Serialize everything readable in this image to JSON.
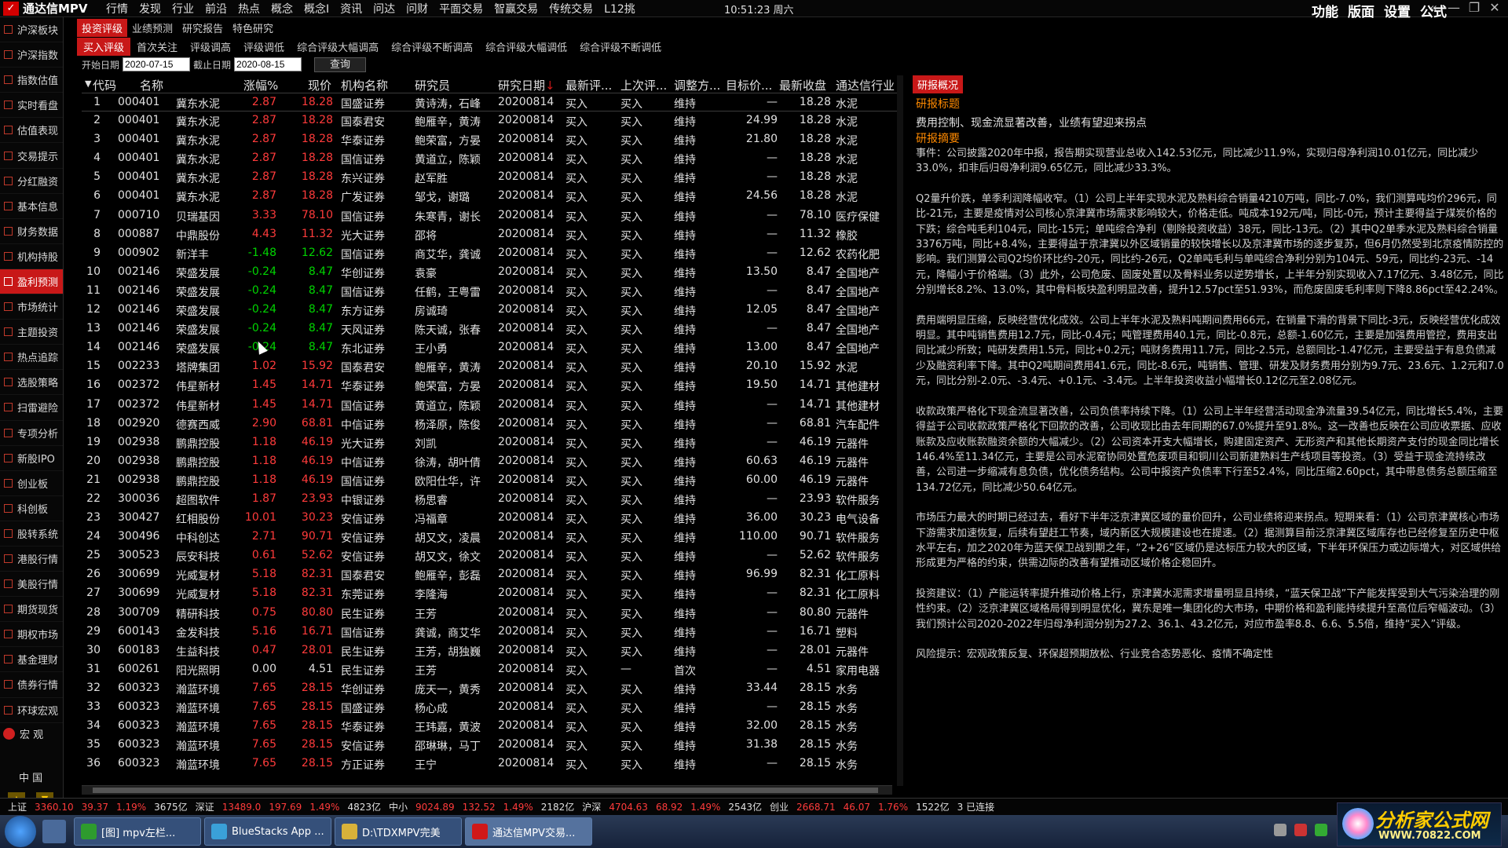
{
  "app": {
    "title": "通达信MPV",
    "clock": "10:51:23 周六"
  },
  "menu": [
    "行情",
    "发现",
    "行业",
    "前沿",
    "热点",
    "概念",
    "概念I",
    "资讯",
    "问达",
    "问财",
    "平面交易",
    "智赢交易",
    "传统交易",
    "L12挑"
  ],
  "right_menu": [
    "功能",
    "版面",
    "设置",
    "公式"
  ],
  "window_controls": {
    "collapse": "«",
    "minimize": "—",
    "restore": "❐",
    "close": "✕"
  },
  "sidebar": {
    "items": [
      "沪深板块",
      "沪深指数",
      "指数估值",
      "实时看盘",
      "估值表现",
      "交易提示",
      "分红融资",
      "基本信息",
      "财务数据",
      "机构持股",
      "盈利预测",
      "市场统计",
      "主题投资",
      "热点追踪",
      "选股策略",
      "扫雷避险",
      "专项分析",
      "新股IPO",
      "创业板",
      "科创板",
      "股转系统",
      "港股行情",
      "美股行情",
      "期货现货",
      "期权市场",
      "基金理财",
      "债券行情",
      "环球宏观"
    ],
    "active_index": 10,
    "macro": "宏  观",
    "china": "中  国",
    "up": "▲",
    "down": "▼"
  },
  "tabs1": [
    "投资评级",
    "业绩预测",
    "研究报告",
    "特色研究"
  ],
  "tabs2": [
    "买入评级",
    "首次关注",
    "评级调高",
    "评级调低",
    "综合评级大幅调高",
    "综合评级不断调高",
    "综合评级大幅调低",
    "综合评级不断调低"
  ],
  "filter": {
    "start_label": "开始日期",
    "start_value": "2020-07-15",
    "end_label": "截止日期",
    "end_value": "2020-08-15",
    "query": "查询"
  },
  "columns": {
    "code": "代码",
    "name": "名称",
    "chg": "涨幅%",
    "price": "现价",
    "org": "机构名称",
    "res": "研究员",
    "date": "研究日期",
    "latest": "最新评...",
    "prev": "上次评...",
    "adj": "调整方...",
    "target": "目标价...",
    "close": "最新收盘",
    "ind": "通达信行业",
    "sort_arrow": "↓"
  },
  "rows": [
    [
      "1",
      "000401",
      "冀东水泥",
      "2.87",
      "18.28",
      "国盛证券",
      "黄诗涛，石峰",
      "20200814",
      "买入",
      "买入",
      "维持",
      "—",
      "18.28",
      "水泥"
    ],
    [
      "2",
      "000401",
      "冀东水泥",
      "2.87",
      "18.28",
      "国泰君安",
      "鲍雁辛，黄涛",
      "20200814",
      "买入",
      "买入",
      "维持",
      "24.99",
      "18.28",
      "水泥"
    ],
    [
      "3",
      "000401",
      "冀东水泥",
      "2.87",
      "18.28",
      "华泰证券",
      "鲍荣富，方晏",
      "20200814",
      "买入",
      "买入",
      "维持",
      "21.80",
      "18.28",
      "水泥"
    ],
    [
      "4",
      "000401",
      "冀东水泥",
      "2.87",
      "18.28",
      "国信证券",
      "黄道立，陈颖",
      "20200814",
      "买入",
      "买入",
      "维持",
      "—",
      "18.28",
      "水泥"
    ],
    [
      "5",
      "000401",
      "冀东水泥",
      "2.87",
      "18.28",
      "东兴证券",
      "赵军胜",
      "20200814",
      "买入",
      "买入",
      "维持",
      "—",
      "18.28",
      "水泥"
    ],
    [
      "6",
      "000401",
      "冀东水泥",
      "2.87",
      "18.28",
      "广发证券",
      "邹戈，谢璐",
      "20200814",
      "买入",
      "买入",
      "维持",
      "24.56",
      "18.28",
      "水泥"
    ],
    [
      "7",
      "000710",
      "贝瑞基因",
      "3.33",
      "78.10",
      "国信证券",
      "朱寒青，谢长",
      "20200814",
      "买入",
      "买入",
      "维持",
      "—",
      "78.10",
      "医疗保健"
    ],
    [
      "8",
      "000887",
      "中鼎股份",
      "4.43",
      "11.32",
      "光大证券",
      "邵将",
      "20200814",
      "买入",
      "买入",
      "维持",
      "—",
      "11.32",
      "橡胶"
    ],
    [
      "9",
      "000902",
      "新洋丰",
      "-1.48",
      "12.62",
      "国信证券",
      "商艾华，龚诚",
      "20200814",
      "买入",
      "买入",
      "维持",
      "—",
      "12.62",
      "农药化肥"
    ],
    [
      "10",
      "002146",
      "荣盛发展",
      "-0.24",
      "8.47",
      "华创证券",
      "袁豪",
      "20200814",
      "买入",
      "买入",
      "维持",
      "13.50",
      "8.47",
      "全国地产"
    ],
    [
      "11",
      "002146",
      "荣盛发展",
      "-0.24",
      "8.47",
      "国信证券",
      "任鹤，王粤雷",
      "20200814",
      "买入",
      "买入",
      "维持",
      "—",
      "8.47",
      "全国地产"
    ],
    [
      "12",
      "002146",
      "荣盛发展",
      "-0.24",
      "8.47",
      "东方证券",
      "房诚琦",
      "20200814",
      "买入",
      "买入",
      "维持",
      "12.05",
      "8.47",
      "全国地产"
    ],
    [
      "13",
      "002146",
      "荣盛发展",
      "-0.24",
      "8.47",
      "天风证券",
      "陈天诚，张春",
      "20200814",
      "买入",
      "买入",
      "维持",
      "—",
      "8.47",
      "全国地产"
    ],
    [
      "14",
      "002146",
      "荣盛发展",
      "-0.24",
      "8.47",
      "东北证券",
      "王小勇",
      "20200814",
      "买入",
      "买入",
      "维持",
      "13.00",
      "8.47",
      "全国地产"
    ],
    [
      "15",
      "002233",
      "塔牌集团",
      "1.02",
      "15.92",
      "国泰君安",
      "鲍雁辛，黄涛",
      "20200814",
      "买入",
      "买入",
      "维持",
      "20.10",
      "15.92",
      "水泥"
    ],
    [
      "16",
      "002372",
      "伟星新材",
      "1.45",
      "14.71",
      "华泰证券",
      "鲍荣富，方晏",
      "20200814",
      "买入",
      "买入",
      "维持",
      "19.50",
      "14.71",
      "其他建材"
    ],
    [
      "17",
      "002372",
      "伟星新材",
      "1.45",
      "14.71",
      "国信证券",
      "黄道立，陈颖",
      "20200814",
      "买入",
      "买入",
      "维持",
      "—",
      "14.71",
      "其他建材"
    ],
    [
      "18",
      "002920",
      "德赛西威",
      "2.90",
      "68.81",
      "中信证券",
      "杨泽原，陈俊",
      "20200814",
      "买入",
      "买入",
      "维持",
      "—",
      "68.81",
      "汽车配件"
    ],
    [
      "19",
      "002938",
      "鹏鼎控股",
      "1.18",
      "46.19",
      "光大证券",
      "刘凯",
      "20200814",
      "买入",
      "买入",
      "维持",
      "—",
      "46.19",
      "元器件"
    ],
    [
      "20",
      "002938",
      "鹏鼎控股",
      "1.18",
      "46.19",
      "中信证券",
      "徐涛，胡叶倩",
      "20200814",
      "买入",
      "买入",
      "维持",
      "60.63",
      "46.19",
      "元器件"
    ],
    [
      "21",
      "002938",
      "鹏鼎控股",
      "1.18",
      "46.19",
      "国信证券",
      "欧阳仕华，许",
      "20200814",
      "买入",
      "买入",
      "维持",
      "60.00",
      "46.19",
      "元器件"
    ],
    [
      "22",
      "300036",
      "超图软件",
      "1.87",
      "23.93",
      "中银证券",
      "杨思睿",
      "20200814",
      "买入",
      "买入",
      "维持",
      "—",
      "23.93",
      "软件服务"
    ],
    [
      "23",
      "300427",
      "红相股份",
      "10.01",
      "30.23",
      "安信证券",
      "冯福章",
      "20200814",
      "买入",
      "买入",
      "维持",
      "36.00",
      "30.23",
      "电气设备"
    ],
    [
      "24",
      "300496",
      "中科创达",
      "2.71",
      "90.71",
      "安信证券",
      "胡又文，凌晨",
      "20200814",
      "买入",
      "买入",
      "维持",
      "110.00",
      "90.71",
      "软件服务"
    ],
    [
      "25",
      "300523",
      "辰安科技",
      "0.61",
      "52.62",
      "安信证券",
      "胡又文，徐文",
      "20200814",
      "买入",
      "买入",
      "维持",
      "—",
      "52.62",
      "软件服务"
    ],
    [
      "26",
      "300699",
      "光威复材",
      "5.18",
      "82.31",
      "国泰君安",
      "鲍雁辛，彭磊",
      "20200814",
      "买入",
      "买入",
      "维持",
      "96.99",
      "82.31",
      "化工原料"
    ],
    [
      "27",
      "300699",
      "光威复材",
      "5.18",
      "82.31",
      "东莞证券",
      "李隆海",
      "20200814",
      "买入",
      "买入",
      "维持",
      "—",
      "82.31",
      "化工原料"
    ],
    [
      "28",
      "300709",
      "精研科技",
      "0.75",
      "80.80",
      "民生证券",
      "王芳",
      "20200814",
      "买入",
      "买入",
      "维持",
      "—",
      "80.80",
      "元器件"
    ],
    [
      "29",
      "600143",
      "金发科技",
      "5.16",
      "16.71",
      "国信证券",
      "龚诚，商艾华",
      "20200814",
      "买入",
      "买入",
      "维持",
      "—",
      "16.71",
      "塑料"
    ],
    [
      "30",
      "600183",
      "生益科技",
      "0.47",
      "28.01",
      "民生证券",
      "王芳，胡独巍",
      "20200814",
      "买入",
      "买入",
      "维持",
      "—",
      "28.01",
      "元器件"
    ],
    [
      "31",
      "600261",
      "阳光照明",
      "0.00",
      "4.51",
      "民生证券",
      "王芳",
      "20200814",
      "买入",
      "—",
      "首次",
      "—",
      "4.51",
      "家用电器"
    ],
    [
      "32",
      "600323",
      "瀚蓝环境",
      "7.65",
      "28.15",
      "华创证券",
      "庞天一，黄秀",
      "20200814",
      "买入",
      "买入",
      "维持",
      "33.44",
      "28.15",
      "水务"
    ],
    [
      "33",
      "600323",
      "瀚蓝环境",
      "7.65",
      "28.15",
      "国盛证券",
      "杨心成",
      "20200814",
      "买入",
      "买入",
      "维持",
      "—",
      "28.15",
      "水务"
    ],
    [
      "34",
      "600323",
      "瀚蓝环境",
      "7.65",
      "28.15",
      "华泰证券",
      "王玮嘉，黄波",
      "20200814",
      "买入",
      "买入",
      "维持",
      "32.00",
      "28.15",
      "水务"
    ],
    [
      "35",
      "600323",
      "瀚蓝环境",
      "7.65",
      "28.15",
      "安信证券",
      "邵琳琳，马丁",
      "20200814",
      "买入",
      "买入",
      "维持",
      "31.38",
      "28.15",
      "水务"
    ],
    [
      "36",
      "600323",
      "瀚蓝环境",
      "7.65",
      "28.15",
      "方正证券",
      "王宁",
      "20200814",
      "买入",
      "买入",
      "维持",
      "—",
      "28.15",
      "水务"
    ]
  ],
  "detail": {
    "title": "研报概况",
    "heading_label": "研报标题",
    "heading": "费用控制、现金流显著改善，业绩有望迎来拐点",
    "summary_label": "研报摘要",
    "paragraphs": [
      "事件：公司披露2020年中报，报告期实现营业总收入142.53亿元，同比减少11.9%，实现归母净利润10.01亿元，同比减少33.0%，扣非后归母净利润9.65亿元，同比减少33.3%。",
      "Q2量升价跌，单季利润降幅收窄。（1）公司上半年实现水泥及熟料综合销量4210万吨，同比-7.0%，我们测算吨均价296元，同比-21元，主要是疫情对公司核心京津冀市场需求影响较大，价格走低。吨成本192元/吨，同比-0元，预计主要得益于煤炭价格的下跌；综合吨毛利104元，同比-15元；单吨综合净利（剔除投资收益）38元，同比-13元。（2）其中Q2单季水泥及熟料综合销量3376万吨，同比+8.4%，主要得益于京津冀以外区域销量的较快增长以及京津冀市场的逐步复苏，但6月仍然受到北京疫情防控的影响。我们测算公司Q2均价环比约-20元，同比约-26元，Q2单吨毛利与单吨综合净利分别为104元、59元，同比约-23元、-14元，降幅小于价格端。（3）此外，公司危废、固废处置以及骨料业务以逆势增长，上半年分别实现收入7.17亿元、3.48亿元，同比分别增长8.2%、13.0%，其中骨料板块盈利明显改善，提升12.57pct至51.93%，而危废固废毛利率则下降8.86pct至42.24%。",
      "费用端明显压缩，反映经营优化成效。公司上半年水泥及熟料吨期间费用66元，在销量下滑的背景下同比-3元，反映经营优化成效明显。其中吨销售费用12.7元，同比-0.4元；吨管理费用40.1元，同比-0.8元，总额-1.60亿元，主要是加强费用管控，费用支出同比减少所致；吨研发费用1.5元，同比+0.2元；吨财务费用11.7元，同比-2.5元，总额同比-1.47亿元，主要受益于有息负债减少及融资利率下降。其中Q2吨期间费用41.6元，同比-8.6元，吨销售、管理、研发及财务费用分别为9.7元、23.6元、1.2元和7.0元，同比分别-2.0元、-3.4元、+0.1元、-3.4元。上半年投资收益小幅增长0.12亿元至2.08亿元。",
      "收款政策严格化下现金流显著改善，公司负债率持续下降。（1）公司上半年经营活动现金净流量39.54亿元，同比增长5.4%，主要得益于公司收款政策严格化下回款的改善，公司收现比由去年同期的67.0%提升至91.8%。这一改善也反映在公司应收票据、应收账款及应收账款融资余额的大幅减少。（2）公司资本开支大幅增长，购建固定资产、无形资产和其他长期资产支付的现金同比增长146.4%至11.34亿元，主要是公司水泥窑协同处置危废项目和铜川公司新建熟料生产线项目等投资。（3）受益于现金流持续改善，公司进一步缩减有息负债，优化债务结构。公司中报资产负债率下行至52.4%，同比压缩2.60pct，其中带息债务总额压缩至134.72亿元，同比减少50.64亿元。",
      "市场压力最大的时期已经过去，看好下半年泛京津冀区域的量价回升，公司业绩将迎来拐点。短期来看：（1）公司京津冀核心市场下游需求加速恢复，后续有望赶工节奏，域内新区大规模建设也在提速。（2）据测算目前泛京津冀区域库存也已经修复至历史中枢水平左右，加之2020年为蓝天保卫战到期之年，“2+26”区域仍是达标压力较大的区域，下半年环保压力或边际增大，对区域供给形成更为严格的约束，供需边际的改善有望推动区域价格企稳回升。",
      "投资建议：（1）产能运转率提升推动价格上行，京津冀水泥需求增量明显且持续，“蓝天保卫战”下产能发挥受到大气污染治理的刚性约束。（2）泛京津冀区域格局得到明显优化，冀东是唯一集团化的大市场，中期价格和盈利能持续提升至高位后窄幅波动。（3）我们预计公司2020-2022年归母净利润分别为27.2、36.1、43.2亿元，对应市盈率8.8、6.6、5.5倍，维持“买入”评级。",
      "风险提示：宏观政策反复、环保超预期放松、行业竞合态势恶化、疫情不确定性"
    ]
  },
  "statusbar": [
    {
      "t": "上证",
      "c": "wht"
    },
    {
      "t": "3360.10",
      "c": "red"
    },
    {
      "t": "39.37",
      "c": "red"
    },
    {
      "t": "1.19%",
      "c": "red"
    },
    {
      "t": "3675亿",
      "c": "wht"
    },
    {
      "t": "深证",
      "c": "wht"
    },
    {
      "t": "13489.0",
      "c": "red"
    },
    {
      "t": "197.69",
      "c": "red"
    },
    {
      "t": "1.49%",
      "c": "red"
    },
    {
      "t": "4823亿",
      "c": "wht"
    },
    {
      "t": "中小",
      "c": "wht"
    },
    {
      "t": "9024.89",
      "c": "red"
    },
    {
      "t": "132.52",
      "c": "red"
    },
    {
      "t": "1.49%",
      "c": "red"
    },
    {
      "t": "2182亿",
      "c": "wht"
    },
    {
      "t": "沪深",
      "c": "wht"
    },
    {
      "t": "4704.63",
      "c": "red"
    },
    {
      "t": "68.92",
      "c": "red"
    },
    {
      "t": "1.49%",
      "c": "red"
    },
    {
      "t": "2543亿",
      "c": "wht"
    },
    {
      "t": "创业",
      "c": "wht"
    },
    {
      "t": "2668.71",
      "c": "red"
    },
    {
      "t": "46.07",
      "c": "red"
    },
    {
      "t": "1.76%",
      "c": "red"
    },
    {
      "t": "1522亿",
      "c": "wht"
    },
    {
      "t": "3 已连接",
      "c": "wht"
    }
  ],
  "taskbar": {
    "items": [
      "[图] mpv左栏...",
      "BlueStacks App ...",
      "D:\\TDXMPV完美",
      "通达信MPV交易..."
    ],
    "active_index": 3
  },
  "watermark": {
    "line1": "分析家公式网",
    "line2": "WWW.70822.COM"
  },
  "colors": {
    "accent": "#c81818",
    "up": "#ff3b3b",
    "down": "#00d400",
    "label": "#ff8a00"
  }
}
